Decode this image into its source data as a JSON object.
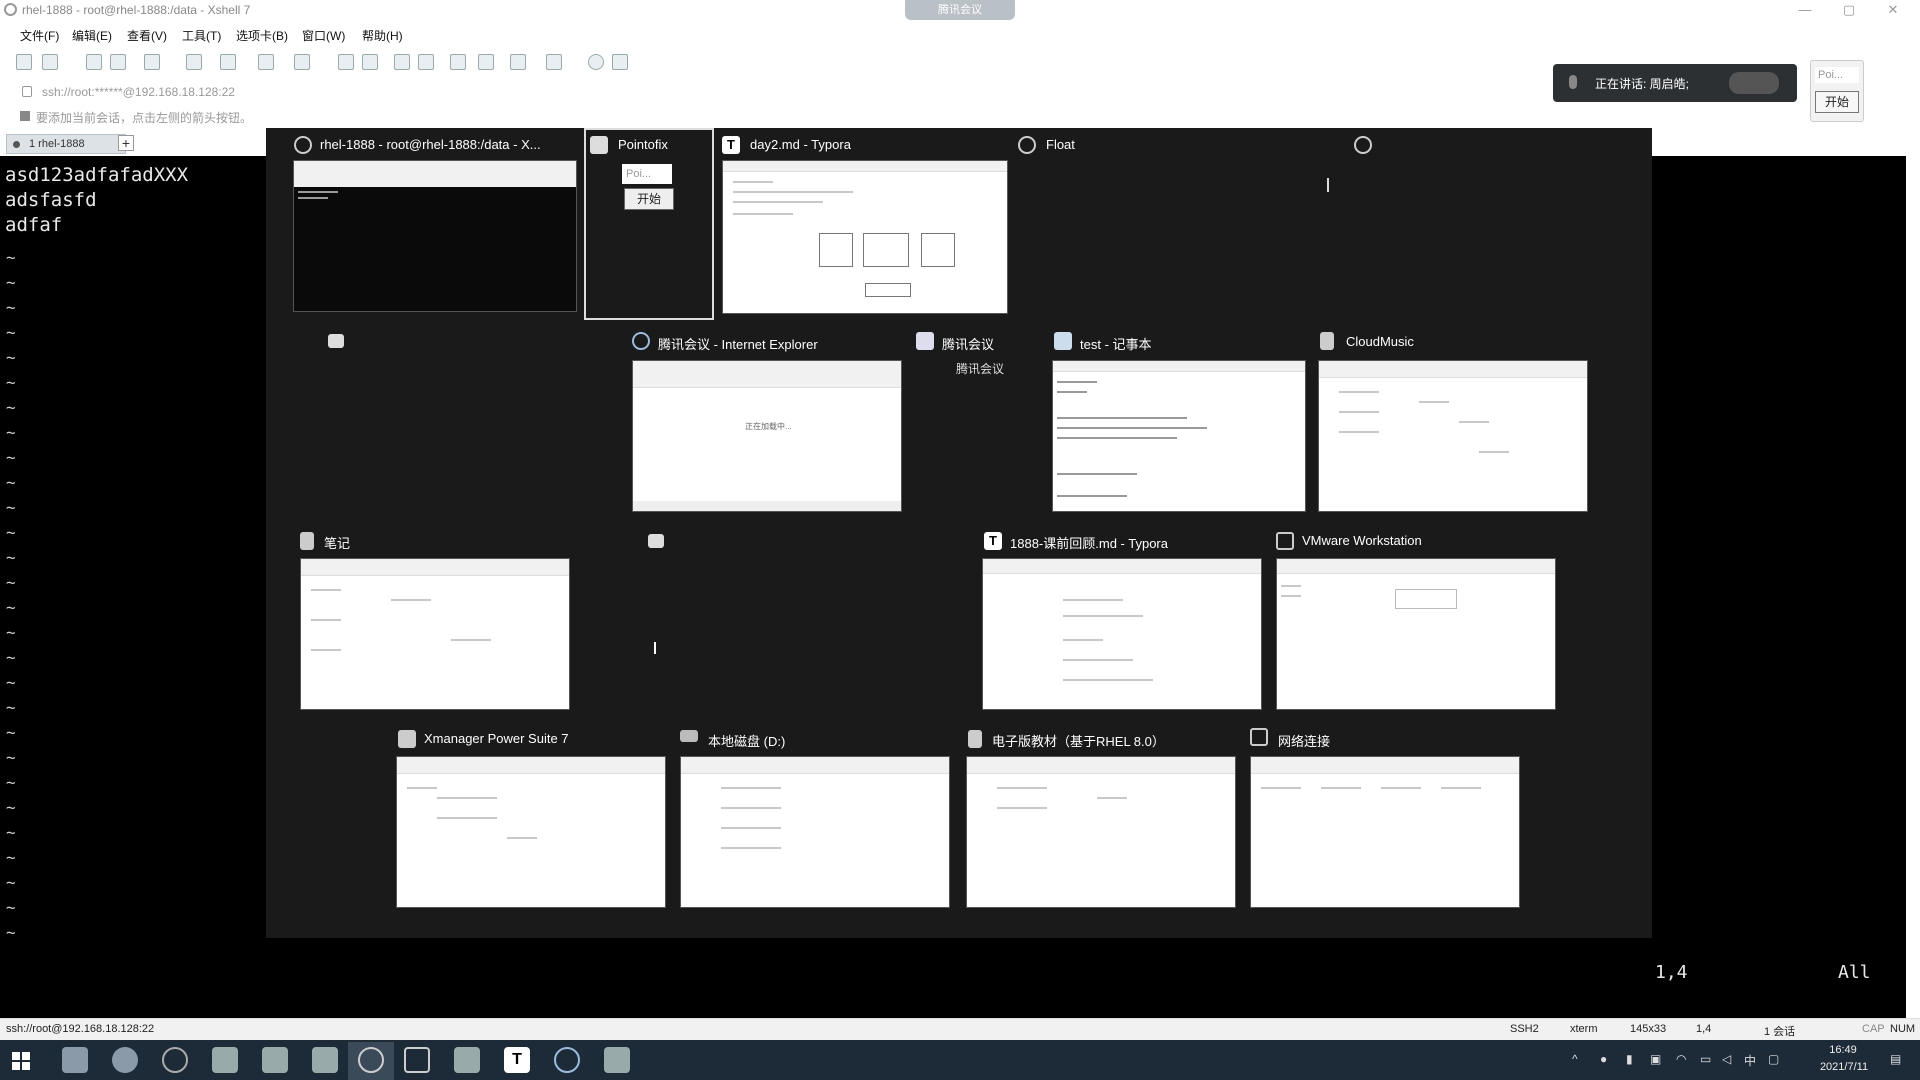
{
  "window": {
    "title": "rhel-1888 - root@rhel-1888:/data - Xshell 7",
    "meeting_pill": "腾讯会议"
  },
  "menu": {
    "items": [
      "文件(F)",
      "编辑(E)",
      "查看(V)",
      "工具(T)",
      "选项卡(B)",
      "窗口(W)",
      "帮助(H)"
    ]
  },
  "address": {
    "value": "ssh://root:******@192.168.18.128:22",
    "hint": "要添加当前会话，点击左侧的箭头按钮。"
  },
  "tabs": {
    "session": "1 rhel-1888",
    "add": "+"
  },
  "terminal": {
    "lines": [
      "asd123adfafadXXX",
      "adsfasfd",
      "adfaf"
    ],
    "cursor_pos": "1,4",
    "scroll_state": "All"
  },
  "meeting_widget": {
    "talking": "正在讲话: 周启皓;",
    "poi": "Poi...",
    "start": "开始"
  },
  "switcher": {
    "row1": [
      {
        "label": "rhel-1888 - root@rhel-1888:/data - X...",
        "icon": "xshell-icon"
      },
      {
        "label": "Pointofix",
        "icon": "pointofix-icon",
        "poi": "Poi...",
        "start": "开始"
      },
      {
        "label": "day2.md - Typora",
        "icon": "typora-icon"
      },
      {
        "label": "Float",
        "icon": "float-icon"
      }
    ],
    "row2": [
      {
        "label": "腾讯会议 - Internet Explorer",
        "icon": "ie-icon",
        "thumb_text": "正在加载中..."
      },
      {
        "label": "腾讯会议",
        "icon": "meeting-icon",
        "sub": "腾讯会议"
      },
      {
        "label": "test - 记事本",
        "icon": "notepad-icon"
      },
      {
        "label": "CloudMusic",
        "icon": "folder-icon"
      }
    ],
    "row3": [
      {
        "label": "笔记",
        "icon": "folder-icon"
      },
      {
        "label": "1888-课前回顾.md - Typora",
        "icon": "typora-icon"
      },
      {
        "label": "VMware Workstation",
        "icon": "vmware-icon"
      }
    ],
    "row4": [
      {
        "label": "Xmanager Power Suite 7",
        "icon": "folder-icon"
      },
      {
        "label": "本地磁盘 (D:)",
        "icon": "drive-icon"
      },
      {
        "label": "电子版教材（基于RHEL 8.0）",
        "icon": "folder-icon"
      },
      {
        "label": "网络连接",
        "icon": "network-icon"
      }
    ]
  },
  "statusbar": {
    "conn": "ssh://root@192.168.18.128:22",
    "protocol": "SSH2",
    "term": "xterm",
    "size": "145x33",
    "pos": "1,4",
    "sessions": "1 会话",
    "cap": "CAP",
    "num": "NUM"
  },
  "taskbar": {
    "time": "16:49",
    "date": "2021/7/11",
    "ime": "中"
  }
}
